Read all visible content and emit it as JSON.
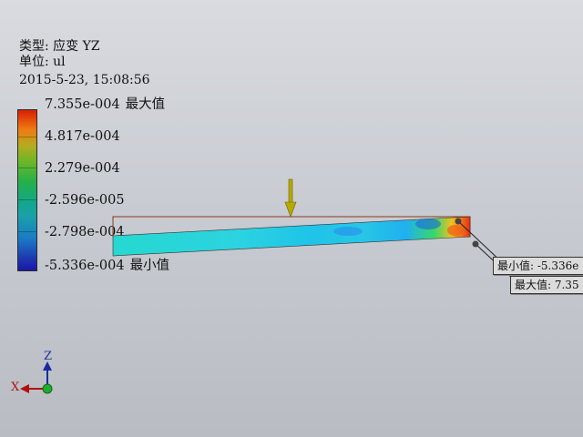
{
  "result_info": {
    "type_label": "类型: 应变 YZ",
    "unit_label": "单位: ul",
    "timestamp": "2015-5-23, 15:08:56"
  },
  "legend": {
    "labels": [
      {
        "value": "7.355e-004",
        "tag": "最大值"
      },
      {
        "value": "4.817e-004",
        "tag": ""
      },
      {
        "value": "2.279e-004",
        "tag": ""
      },
      {
        "value": "-2.596e-005",
        "tag": ""
      },
      {
        "value": "-2.798e-004",
        "tag": ""
      },
      {
        "value": "-5.336e-004",
        "tag": "最小值"
      }
    ],
    "colors": [
      "#d81e05",
      "#f07a12",
      "#b4ac1e",
      "#6db626",
      "#23b04b",
      "#14a68c",
      "#1a7bc4",
      "#1818a8"
    ]
  },
  "callouts": {
    "min_label": "最小值: -5.336e",
    "max_label": "最大值: 7.35"
  },
  "load_arrow_color": "#b8a800",
  "triad": {
    "z_label": "Z",
    "x_label": "X",
    "origin_color": "#22aa33"
  }
}
